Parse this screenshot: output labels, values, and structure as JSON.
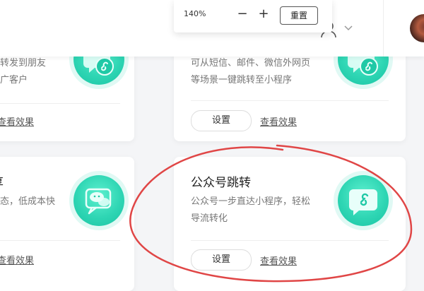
{
  "zoom": {
    "level": "140%",
    "minus": "−",
    "plus": "+",
    "reset": "重置"
  },
  "cards": {
    "top_left": {
      "desc_line1": "转发到朋友",
      "desc_line2": "广客户",
      "view": "查看效果"
    },
    "top_right": {
      "desc_line1": "可从短信、邮件、微信外网页",
      "desc_line2": "等场景一键跳转至小程序",
      "set": "设置",
      "view": "查看效果"
    },
    "bottom_left": {
      "title": "享",
      "desc_line1": "态，低成本快",
      "view": "查看效果"
    },
    "bottom_right": {
      "title": "公众号跳转",
      "desc_line1": "公众号一步直达小程序，轻松",
      "desc_line2": "导流转化",
      "set": "设置",
      "view": "查看效果"
    }
  },
  "icons": {
    "user": "user-icon",
    "chevron": "chevron-down-icon",
    "link_chat": "link-chat-icon",
    "wechat": "wechat-icon"
  },
  "colors": {
    "accent": "#2fd6b4",
    "annotation": "#e04646"
  }
}
